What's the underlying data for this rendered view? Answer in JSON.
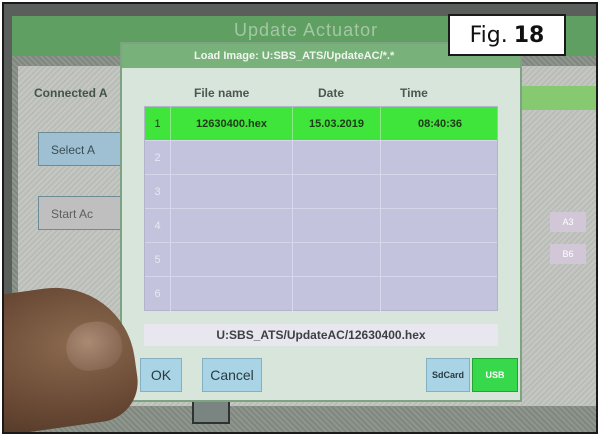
{
  "background": {
    "title": "Update Actuator",
    "connected_label": "Connected A",
    "select_button": "Select A",
    "start_button": "Start Ac",
    "right_a3": "A3",
    "right_b6": "B6"
  },
  "dialog": {
    "title": "Load Image: U:SBS_ATS/UpdateAC/*.*",
    "columns": [
      "File name",
      "Date",
      "Time"
    ],
    "rows": [
      {
        "num": "1",
        "file": "12630400.hex",
        "date": "15.03.2019",
        "time": "08:40:36"
      },
      {
        "num": "2",
        "file": "",
        "date": "",
        "time": ""
      },
      {
        "num": "3",
        "file": "",
        "date": "",
        "time": ""
      },
      {
        "num": "4",
        "file": "",
        "date": "",
        "time": ""
      },
      {
        "num": "5",
        "file": "",
        "date": "",
        "time": ""
      },
      {
        "num": "6",
        "file": "",
        "date": "",
        "time": ""
      }
    ],
    "selected_path": "U:SBS_ATS/UpdateAC/12630400.hex",
    "buttons": {
      "ok": "OK",
      "cancel": "Cancel",
      "sdcard": "SdCard",
      "usb": "USB"
    }
  },
  "figure": {
    "label": "Fig.",
    "number": "18"
  },
  "colors": {
    "selected_row": "#3fe53b",
    "header": "#78b179",
    "usb_active": "#37d84b"
  }
}
